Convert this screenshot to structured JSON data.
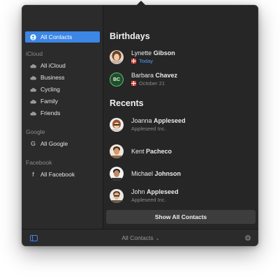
{
  "sidebar": {
    "all_contacts": "All Contacts",
    "groups": [
      {
        "title": "iCloud",
        "items": [
          "All iCloud",
          "Business",
          "Cycling",
          "Family",
          "Friends"
        ]
      },
      {
        "title": "Google",
        "items": [
          "All Google"
        ]
      },
      {
        "title": "Facebook",
        "items": [
          "All Facebook"
        ]
      }
    ]
  },
  "main": {
    "birthdays_title": "Birthdays",
    "birthdays": [
      {
        "first": "Lynette",
        "last": "Gibson",
        "date": "Today"
      },
      {
        "first": "Barbara",
        "last": "Chavez",
        "date": "October 21",
        "initials": "BC"
      }
    ],
    "recents_title": "Recents",
    "recents": [
      {
        "first": "Joanna",
        "last": "Appleseed",
        "company": "Appleseed Inc."
      },
      {
        "first": "Kent",
        "last": "Pacheco"
      },
      {
        "first": "Michael",
        "last": "Johnson"
      },
      {
        "first": "John",
        "last": "Appleseed",
        "company": "Appleseed Inc."
      }
    ],
    "show_all_label": "Show All Contacts"
  },
  "footer": {
    "title": "All Contacts"
  },
  "colors": {
    "accent": "#3c86e6",
    "today": "#4f9bf5",
    "gift": "#d9443a"
  },
  "icons": [
    "contacts-icon",
    "cloud-icon",
    "google-g-icon",
    "facebook-f-icon",
    "gift-icon",
    "sidebar-toggle-icon",
    "gear-icon",
    "chevron-down-icon"
  ]
}
